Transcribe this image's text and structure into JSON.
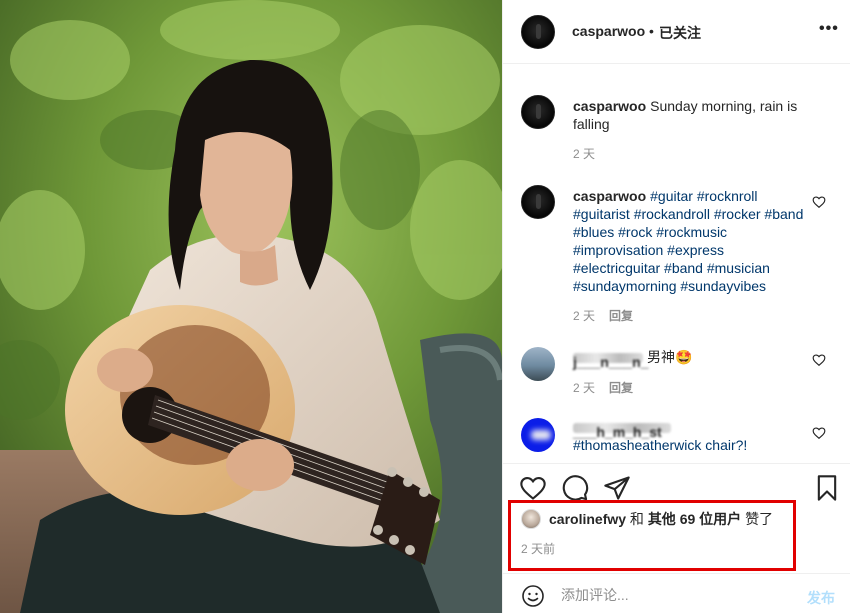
{
  "post": {
    "author": "casparwoo",
    "follow_separator": "•",
    "follow_status": "已关注",
    "more_icon": "more-horizontal-icon",
    "photo_icon": "person-playing-guitar-photo"
  },
  "comments": [
    {
      "user": "casparwoo",
      "text": "Sunday morning, rain is falling",
      "time": "2 天",
      "avatar": "dark"
    },
    {
      "user": "casparwoo",
      "text": "#guitar #rocknroll #guitarist #rockandroll #rocker #band #blues #rock #rockmusic #improvisation #express #electricguitar #band #musician #sundaymorning #sundayvibes",
      "time": "2 天",
      "reply": "回复",
      "avatar": "dark"
    },
    {
      "user": "j___n___n_",
      "text": "男神🤩",
      "time": "2 天",
      "reply": "回复",
      "avatar": "photo"
    },
    {
      "user": "___h_m_h_st",
      "text": "#thomasheatherwick chair?!",
      "avatar": "blue"
    }
  ],
  "likes": {
    "first_user": "carolinefwy",
    "and": "和",
    "others": "其他 69 位用户",
    "suffix": "赞了",
    "time": "2 天前"
  },
  "add_comment": {
    "placeholder": "添加评论...",
    "post_label": "发布"
  },
  "colors": {
    "hashtag": "#00376b",
    "highlight_box": "#e10000",
    "post_button_disabled": "#b2dffc",
    "muted_text": "#8e8e8e"
  }
}
